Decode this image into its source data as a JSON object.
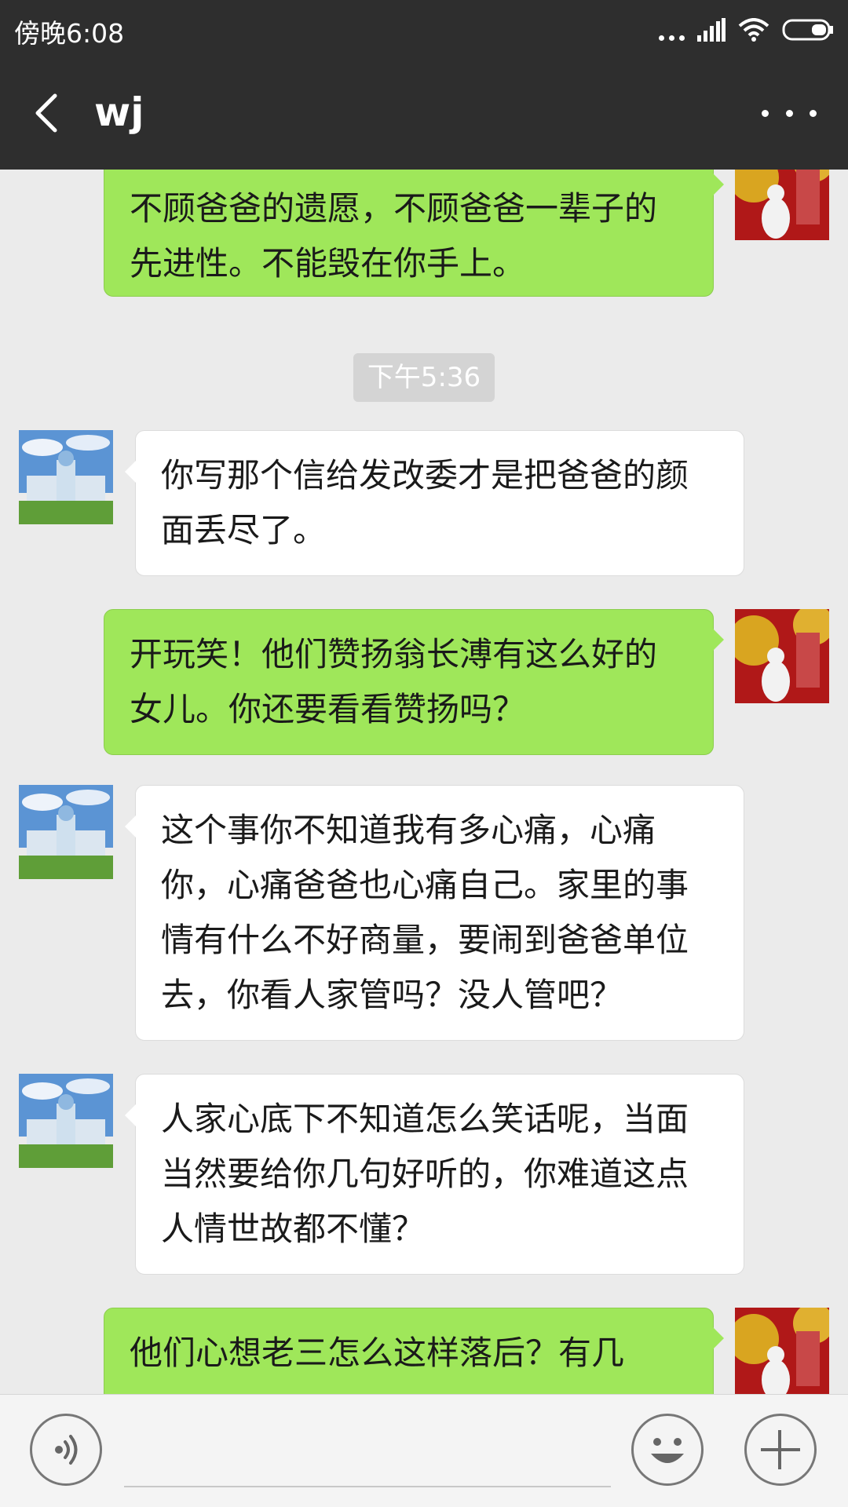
{
  "status_bar": {
    "time": "傍晚6:08"
  },
  "header": {
    "title": "wj"
  },
  "messages": [
    {
      "direction": "out",
      "text": "不顾爸爸的遗愿，不顾爸爸一辈子的先进性。不能毁在你手上。"
    },
    {
      "direction": "in",
      "text": "你写那个信给发改委才是把爸爸的颜面丢尽了。"
    },
    {
      "direction": "out",
      "text": "开玩笑！他们赞扬翁长溥有这么好的女儿。你还要看看赞扬吗？"
    },
    {
      "direction": "in",
      "text": "这个事你不知道我有多心痛，心痛你，心痛爸爸也心痛自己。家里的事情有什么不好商量，要闹到爸爸单位去，你看人家管吗？没人管吧？"
    },
    {
      "direction": "in",
      "text": "人家心底下不知道怎么笑话呢，当面当然要给你几句好听的，你难道这点人情世故都不懂？"
    },
    {
      "direction": "out",
      "text": "他们心想老三怎么这样落后？有几"
    }
  ],
  "timestamp": "下午5:36",
  "icons": {
    "back": "back-arrow-icon",
    "more": "more-dots-icon",
    "voice": "voice-icon",
    "emoji": "emoji-icon",
    "plus": "plus-icon"
  },
  "colors": {
    "header_bg": "#2e2e2e",
    "chat_bg": "#ebebeb",
    "outgoing_bubble": "#9fe75a",
    "incoming_bubble": "#ffffff"
  }
}
